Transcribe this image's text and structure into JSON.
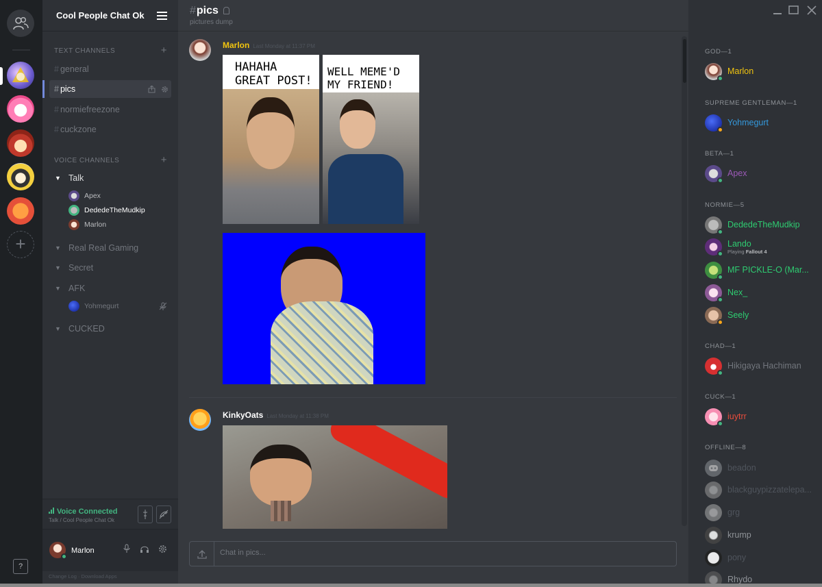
{
  "server": {
    "name": "Cool People Chat Ok"
  },
  "sidebar": {
    "text_category": "TEXT CHANNELS",
    "voice_category": "VOICE CHANNELS",
    "text_channels": [
      {
        "label": "general"
      },
      {
        "label": "pics"
      },
      {
        "label": "normiefreezone"
      },
      {
        "label": "cuckzone"
      }
    ],
    "voice_channels": {
      "talk": "Talk",
      "talk_users": [
        "Apex",
        "DededeTheMudkip",
        "Marlon"
      ],
      "real_gaming": "Real Real Gaming",
      "secret": "Secret",
      "afk": "AFK",
      "afk_users": [
        "Yohmegurt"
      ],
      "cucked": "CUCKED"
    }
  },
  "voice_status": {
    "label": "Voice Connected",
    "sub": "Talk / Cool People Chat Ok"
  },
  "user_panel": {
    "name": "Marlon"
  },
  "footer": {
    "links": "Change Log  ·  Download Apps"
  },
  "help": {
    "label": "?"
  },
  "channel": {
    "name": "pics",
    "hash": "#",
    "topic": "pictures dump"
  },
  "messages": [
    {
      "author": "Marlon",
      "author_color": "#f1c40f",
      "time": "Last Monday at 11:37 PM",
      "meme_left_caption": "HAHAHA GREAT POST!",
      "meme_right_caption": "WELL MEME'D MY FRIEND!"
    },
    {
      "author": "KinkyOats",
      "author_color": "#ffffff",
      "time": "Last Monday at 11:38 PM"
    }
  ],
  "input": {
    "placeholder": "Chat in pics..."
  },
  "members": {
    "groups": [
      {
        "title": "GOD—1",
        "users": [
          {
            "name": "Marlon",
            "color": "#f1c40f",
            "status": "online"
          }
        ]
      },
      {
        "title": "SUPREME GENTLEMAN—1",
        "users": [
          {
            "name": "Yohmegurt",
            "color": "#3498db",
            "status": "idle"
          }
        ]
      },
      {
        "title": "BETA—1",
        "users": [
          {
            "name": "Apex",
            "color": "#9b59b6",
            "status": "online"
          }
        ]
      },
      {
        "title": "NORMIE—5",
        "users": [
          {
            "name": "DededeTheMudkip",
            "color": "#2ecc71",
            "status": "online"
          },
          {
            "name": "Lando",
            "color": "#2ecc71",
            "status": "online",
            "playing_prefix": "Playing",
            "game": "Fallout 4"
          },
          {
            "name": "MF PICKLE-O (Mar...",
            "color": "#2ecc71",
            "status": "online"
          },
          {
            "name": "Nex_",
            "color": "#2ecc71",
            "status": "online"
          },
          {
            "name": "Seely",
            "color": "#2ecc71",
            "status": "idle"
          }
        ]
      },
      {
        "title": "CHAD—1",
        "users": [
          {
            "name": "Hikigaya Hachiman",
            "color": "#72767d",
            "status": "online"
          }
        ]
      },
      {
        "title": "CUCK—1",
        "users": [
          {
            "name": "iuytrr",
            "color": "#e74c3c",
            "status": "online"
          }
        ]
      },
      {
        "title": "OFFLINE—8",
        "users": [
          {
            "name": "beadon"
          },
          {
            "name": "blackguypizzatelepa..."
          },
          {
            "name": "grg"
          },
          {
            "name": "krump"
          },
          {
            "name": "pony"
          },
          {
            "name": "Rhydo"
          }
        ]
      }
    ]
  },
  "colors": {
    "accent": "#7289da",
    "online": "#43b581",
    "idle": "#faa61a",
    "bg_main": "#36393e",
    "bg_side": "#2e3136"
  }
}
